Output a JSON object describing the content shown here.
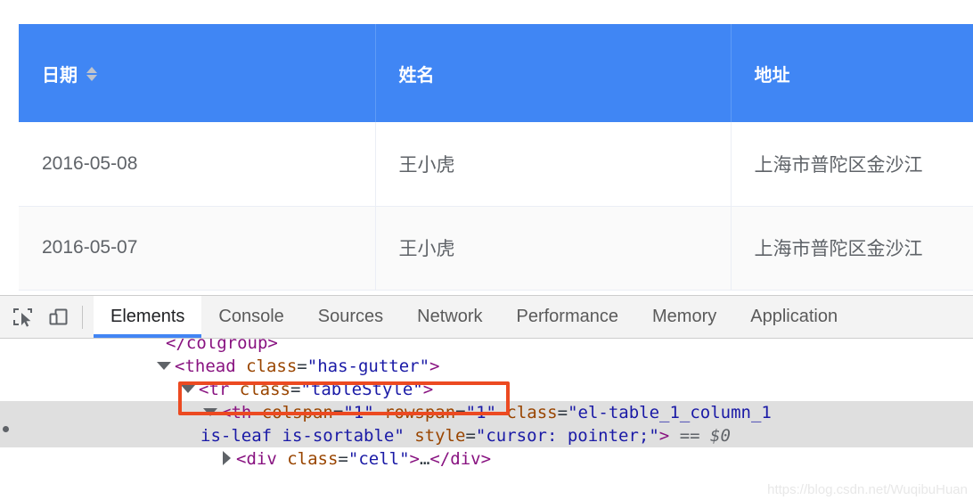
{
  "page": {
    "table": {
      "columns": [
        {
          "label": "日期",
          "sortable": true,
          "sort_icon": "sort-caret-icon"
        },
        {
          "label": "姓名",
          "sortable": false
        },
        {
          "label": "地址",
          "sortable": false
        }
      ],
      "rows": [
        {
          "date": "2016-05-08",
          "name": "王小虎",
          "address": "上海市普陀区金沙江"
        },
        {
          "date": "2016-05-07",
          "name": "王小虎",
          "address": "上海市普陀区金沙江"
        }
      ],
      "header_bg": "#4086f4",
      "header_text_color": "#ffffff",
      "stripe_bg": "#fafafa"
    }
  },
  "devtools": {
    "toolbar": {
      "inspect_icon": "inspect-element-icon",
      "device_icon": "device-toolbar-icon"
    },
    "tabs": [
      {
        "label": "Elements",
        "active": true
      },
      {
        "label": "Console",
        "active": false
      },
      {
        "label": "Sources",
        "active": false
      },
      {
        "label": "Network",
        "active": false
      },
      {
        "label": "Performance",
        "active": false
      },
      {
        "label": "Memory",
        "active": false
      },
      {
        "label": "Application",
        "active": false
      }
    ],
    "active_tab_underline": "#4285f4",
    "dom": {
      "line_colgroup_close": "</colgroup>",
      "line_thead": {
        "tag_open": "<thead",
        "attr": "class",
        "eq": "=",
        "value": "\"has-gutter\"",
        "close": ">"
      },
      "line_tr": {
        "tag_open": "<tr",
        "attr": "class",
        "eq": "=",
        "value": "\"tableStyle\"",
        "close": ">"
      },
      "line_th_1": {
        "tag_open": "<th",
        "attr1": "colspan",
        "val1": "\"1\"",
        "attr2": "rowspan",
        "val2": "\"1\"",
        "attr3": "class",
        "val3": "\"el-table_1_column_1"
      },
      "line_th_2": {
        "val_cont": "is-leaf is-sortable\"",
        "attr_style": "style",
        "val_style": "\"cursor: pointer;\"",
        "close": ">",
        "selected_marker": "== $0"
      },
      "line_cell": {
        "tag_open": "<div",
        "attr": "class",
        "eq": "=",
        "value": "\"cell\"",
        "close": ">",
        "ellipsis": "…",
        "tag_close": "</div>"
      },
      "selection_bg": "#dfdfdf",
      "annotation_color": "#ec4a21"
    }
  },
  "watermark": "https://blog.csdn.net/WuqibuHuan"
}
